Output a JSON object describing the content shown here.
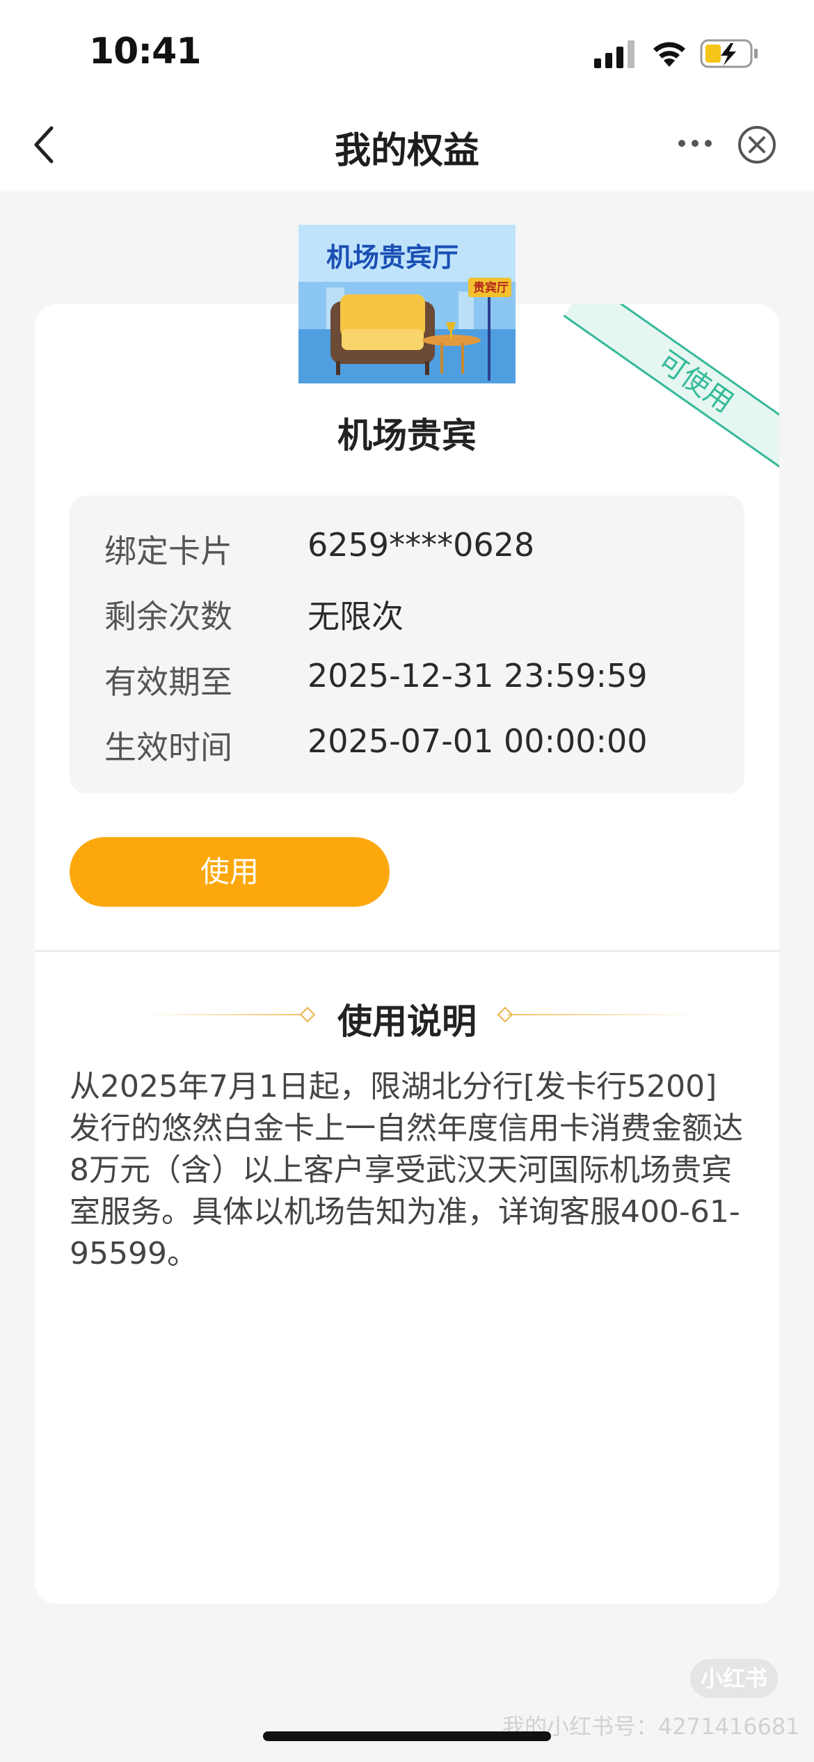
{
  "status_bar": {
    "time": "10:41"
  },
  "nav": {
    "title": "我的权益"
  },
  "benefit": {
    "status_ribbon": "可使用",
    "image_banner_text": "机场贵宾厅",
    "image_sign_text": "贵宾厅",
    "title": "机场贵宾"
  },
  "info": {
    "rows": [
      {
        "label": "绑定卡片",
        "value": "6259****0628"
      },
      {
        "label": "剩余次数",
        "value": "无限次"
      },
      {
        "label": "有效期至",
        "value": "2025-12-31 23:59:59"
      },
      {
        "label": "生效时间",
        "value": "2025-07-01 00:00:00"
      }
    ]
  },
  "actions": {
    "use_label": "使用"
  },
  "instructions": {
    "title": "使用说明",
    "text": "从2025年7月1日起，限湖北分行[发卡行5200]发行的悠然白金卡上一自然年度信用卡消费金额达8万元（含）以上客户享受武汉天河国际机场贵宾室服务。具体以机场告知为准，详询客服400-61-95599。"
  },
  "watermark": {
    "logo_text": "小红书",
    "id_text": "我的小红书号：4271416681"
  },
  "colors": {
    "accent": "#fca80d",
    "ribbon": "#35b99a",
    "gold_line": "#f0c060"
  }
}
